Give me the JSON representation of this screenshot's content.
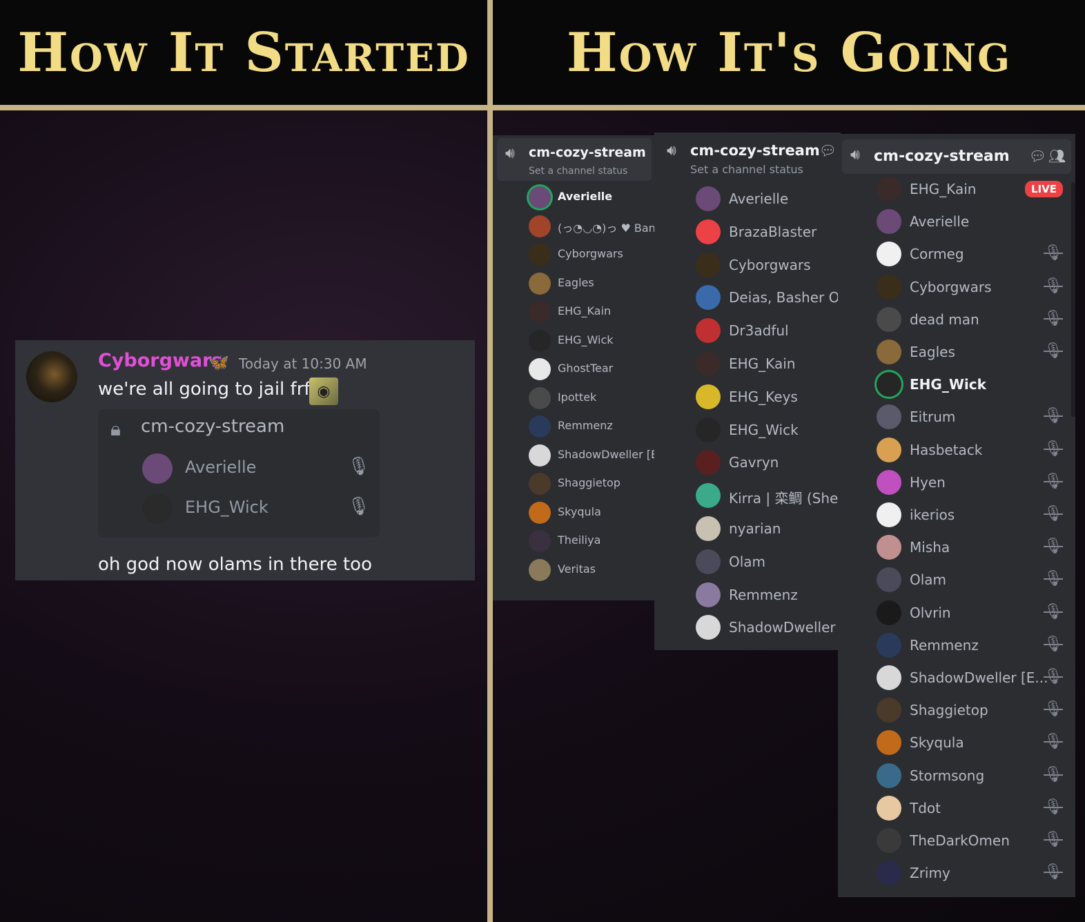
{
  "headers": {
    "left": "How It Started",
    "right": "How It's Going"
  },
  "chat": {
    "author": "Cyborgwars",
    "author_color": "#e04fd6",
    "badge_icon": "butterfly-icon",
    "timestamp": "Today at 10:30 AM",
    "message1": "we're all going to jail frfr",
    "emote_icon": "emote-icon",
    "embed": {
      "channel": "cm-cozy-stream",
      "members": [
        {
          "name": "Averielle",
          "color": "#6b4a78"
        },
        {
          "name": "EHG_Wick",
          "color": "#2a2a2a"
        }
      ]
    },
    "message2": "oh god now olams in there too"
  },
  "panel1": {
    "channel": "cm-cozy-stream",
    "status": "Set a channel status",
    "members": [
      {
        "name": "Averielle",
        "color": "#6b4a78",
        "speaking": true
      },
      {
        "name": "(っ◔◡◔)っ ♥ Ban",
        "color": "#a0442a"
      },
      {
        "name": "Cyborgwars",
        "color": "#3a2e1a"
      },
      {
        "name": "Eagles",
        "color": "#8a6a3a"
      },
      {
        "name": "EHG_Kain",
        "color": "#3a2a2a"
      },
      {
        "name": "EHG_Wick",
        "color": "#262626"
      },
      {
        "name": "GhostTear",
        "color": "#e8e8e8"
      },
      {
        "name": "Ipottek",
        "color": "#4a4a4a"
      },
      {
        "name": "Remmenz",
        "color": "#2a3a5a"
      },
      {
        "name": "ShadowDweller [E",
        "color": "#d8d8d8"
      },
      {
        "name": "Shaggietop",
        "color": "#4a3a2a"
      },
      {
        "name": "Skyqula",
        "color": "#c06a1a"
      },
      {
        "name": "Theiliya",
        "color": "#3a3040"
      },
      {
        "name": "Veritas",
        "color": "#8a7a5a"
      }
    ]
  },
  "panel2": {
    "channel": "cm-cozy-stream",
    "status": "Set a channel status",
    "members": [
      {
        "name": "Averielle",
        "color": "#6b4a78"
      },
      {
        "name": "BrazaBlaster",
        "color": "#ed4245"
      },
      {
        "name": "Cyborgwars",
        "color": "#3a2e1a"
      },
      {
        "name": "Deias, Basher Of E",
        "color": "#3a6aaa"
      },
      {
        "name": "Dr3adful",
        "color": "#c03030"
      },
      {
        "name": "EHG_Kain",
        "color": "#3a2a2a"
      },
      {
        "name": "EHG_Keys",
        "color": "#d8b82a"
      },
      {
        "name": "EHG_Wick",
        "color": "#262626"
      },
      {
        "name": "Gavryn",
        "color": "#5a2020"
      },
      {
        "name": "Kirra | 栾鲷 (She/I",
        "color": "#3aaa8a"
      },
      {
        "name": "nyarian",
        "color": "#c8c0b0"
      },
      {
        "name": "Olam",
        "color": "#4a4a5a"
      },
      {
        "name": "Remmenz",
        "color": "#8a7aa0"
      },
      {
        "name": "ShadowDweller [E",
        "color": "#d8d8d8"
      }
    ]
  },
  "panel3": {
    "channel": "cm-cozy-stream",
    "live_label": "LIVE",
    "members": [
      {
        "name": "EHG_Kain",
        "color": "#3a2a2a",
        "live": true
      },
      {
        "name": "Averielle",
        "color": "#6b4a78"
      },
      {
        "name": "Cormeg",
        "color": "#f0f0f0",
        "muted": true
      },
      {
        "name": "Cyborgwars",
        "color": "#3a2e1a",
        "muted": true
      },
      {
        "name": "dead man",
        "color": "#4a4a4a",
        "muted": true
      },
      {
        "name": "Eagles",
        "color": "#8a6a3a",
        "muted": true
      },
      {
        "name": "EHG_Wick",
        "color": "#262626",
        "speaking": true
      },
      {
        "name": "Eitrum",
        "color": "#5a5a6a",
        "muted": true
      },
      {
        "name": "Hasbetack",
        "color": "#d8a050",
        "muted": true
      },
      {
        "name": "Hyen",
        "color": "#c050c0",
        "muted": true
      },
      {
        "name": "ikerios",
        "color": "#f0f0f0",
        "muted": true
      },
      {
        "name": "Misha",
        "color": "#c09090",
        "muted": true
      },
      {
        "name": "Olam",
        "color": "#4a4a5a",
        "muted": true
      },
      {
        "name": "Olvrin",
        "color": "#1a1a1a",
        "muted": true
      },
      {
        "name": "Remmenz",
        "color": "#2a3a5a",
        "muted": true
      },
      {
        "name": "ShadowDweller [E...",
        "color": "#d8d8d8",
        "muted": true
      },
      {
        "name": "Shaggietop",
        "color": "#4a3a2a",
        "muted": true
      },
      {
        "name": "Skyqula",
        "color": "#c06a1a",
        "muted": true
      },
      {
        "name": "Stormsong",
        "color": "#3a6a8a",
        "muted": true
      },
      {
        "name": "Tdot",
        "color": "#e8c8a0",
        "muted": true
      },
      {
        "name": "TheDarkOmen",
        "color": "#3a3a3a",
        "muted": true
      },
      {
        "name": "Zrimy",
        "color": "#2a2a4a",
        "muted": true
      }
    ]
  }
}
